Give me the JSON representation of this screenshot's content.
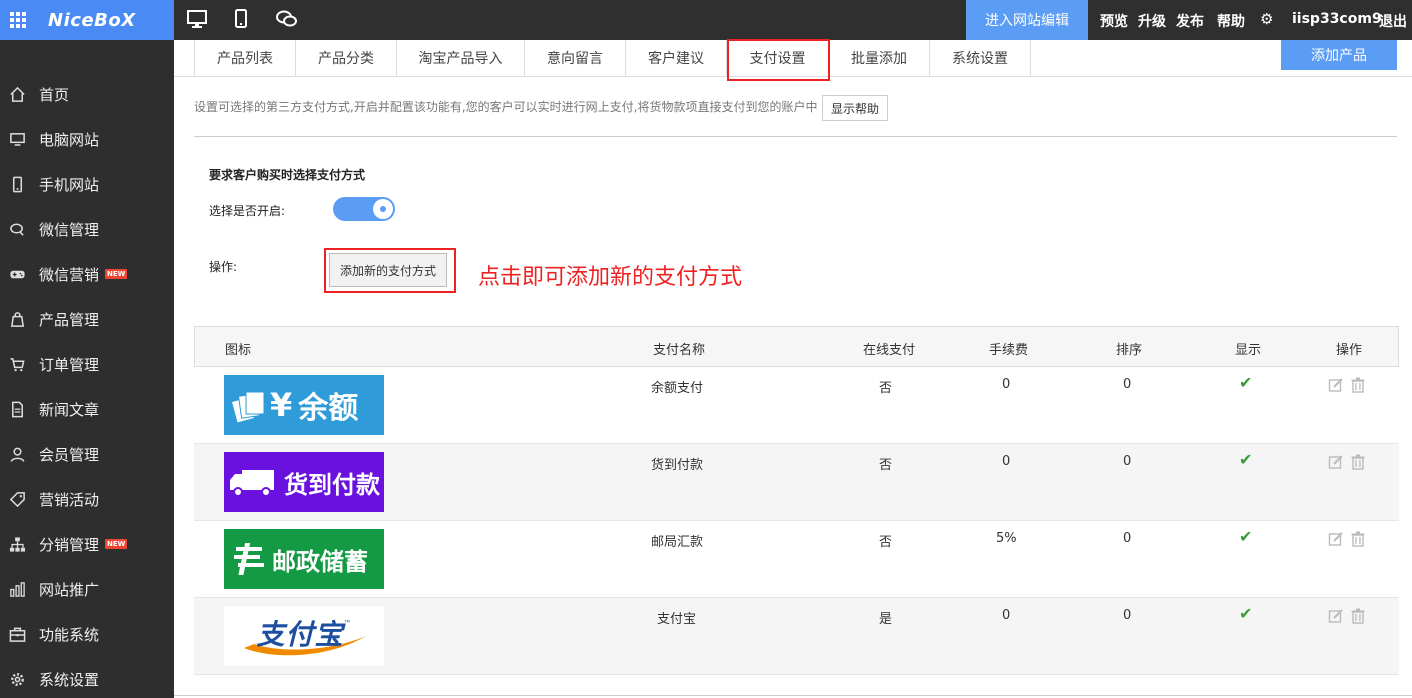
{
  "topbar": {
    "logo": "NiceBoX",
    "enter_edit": "进入网站编辑",
    "links": [
      "预览",
      "升级",
      "发布",
      "帮助"
    ],
    "username": "iisp33com9",
    "logout": "退出"
  },
  "sidebar": {
    "items": [
      {
        "label": "首页",
        "icon": "home-icon"
      },
      {
        "label": "电脑网站",
        "icon": "desktop-icon"
      },
      {
        "label": "手机网站",
        "icon": "mobile-icon"
      },
      {
        "label": "微信管理",
        "icon": "chat-icon"
      },
      {
        "label": "微信营销",
        "icon": "gamepad-icon",
        "badge": "NEW"
      },
      {
        "label": "产品管理",
        "icon": "bag-icon"
      },
      {
        "label": "订单管理",
        "icon": "cart-icon"
      },
      {
        "label": "新闻文章",
        "icon": "document-icon"
      },
      {
        "label": "会员管理",
        "icon": "user-icon"
      },
      {
        "label": "营销活动",
        "icon": "tag-icon"
      },
      {
        "label": "分销管理",
        "icon": "sitemap-icon",
        "badge": "NEW"
      },
      {
        "label": "网站推广",
        "icon": "bar-chart-icon"
      },
      {
        "label": "功能系统",
        "icon": "toolbox-icon"
      },
      {
        "label": "系统设置",
        "icon": "gear-icon"
      }
    ]
  },
  "tabs": [
    "产品列表",
    "产品分类",
    "淘宝产品导入",
    "意向留言",
    "客户建议",
    "支付设置",
    "批量添加",
    "系统设置"
  ],
  "active_tab": "支付设置",
  "add_product": "添加产品",
  "description": "设置可选择的第三方支付方式,开启并配置该功能有,您的客户可以实时进行网上支付,将货物款项直接支付到您的账户中",
  "show_help": "显示帮助",
  "settings": {
    "title": "要求客户购买时选择支付方式",
    "enable_label": "选择是否开启:",
    "enabled": true,
    "operation_label": "操作:",
    "add_payment_button": "添加新的支付方式",
    "annotation": "点击即可添加新的支付方式"
  },
  "table": {
    "headers": [
      "图标",
      "支付名称",
      "在线支付",
      "手续费",
      "排序",
      "显示",
      "操作"
    ],
    "rows": [
      {
        "logo_text": "余额",
        "logo_symbol": "¥",
        "name": "余额支付",
        "online": "否",
        "fee": "0",
        "order": "0",
        "logo_bg": "#2f9bd8"
      },
      {
        "logo_text": "货到付款",
        "name": "货到付款",
        "online": "否",
        "fee": "0",
        "order": "0",
        "logo_bg": "#6a11e0"
      },
      {
        "logo_text": "邮政储蓄",
        "name": "邮局汇款",
        "online": "否",
        "fee": "5%",
        "order": "0",
        "logo_bg": "#149a44"
      },
      {
        "logo_text": "支付宝",
        "logo_tm": "™",
        "name": "支付宝",
        "online": "是",
        "fee": "0",
        "order": "0",
        "logo_bg": "#ffffff"
      }
    ]
  },
  "colors": {
    "accent": "#5b9cf4",
    "sidebar_bg": "#2e2e2e",
    "topbar_bg": "#2f2f2f",
    "highlight_red": "#e22",
    "check_green": "#3a9b3a"
  }
}
